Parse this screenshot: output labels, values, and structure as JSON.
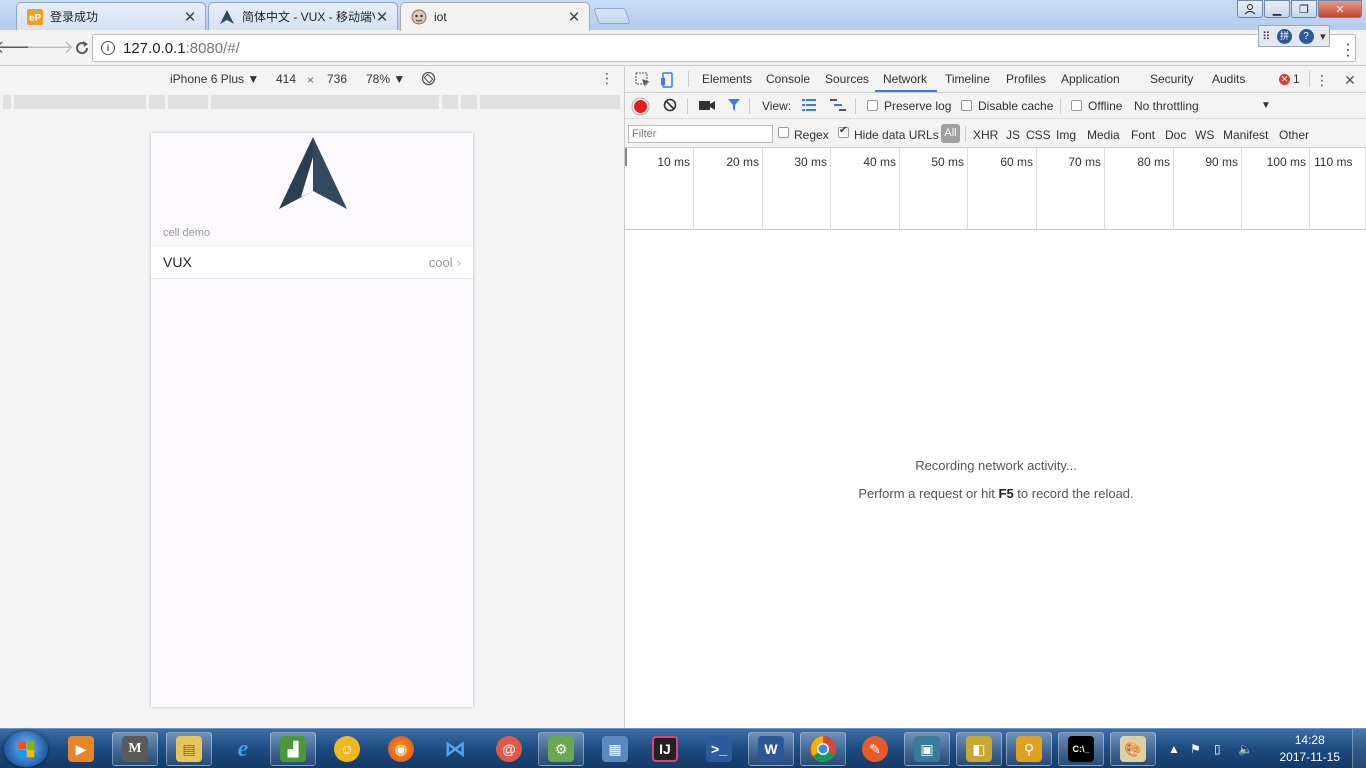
{
  "tabs": [
    {
      "title": "登录成功",
      "icon": "ep-icon"
    },
    {
      "title": "简体中文 - VUX - 移动端V",
      "icon": "vux-icon"
    },
    {
      "title": "iot",
      "icon": "iot-favicon"
    }
  ],
  "toolbar": {
    "url_host": "127.0.0.1",
    "url_rest": ":8080/#/"
  },
  "device_toolbar": {
    "device": "iPhone 6 Plus",
    "width": "414",
    "times": "×",
    "height": "736",
    "zoom": "78%"
  },
  "app": {
    "cell_title": "cell demo",
    "cell_label": "VUX",
    "cell_value": "cool"
  },
  "devtools": {
    "tabs": [
      "Elements",
      "Console",
      "Sources",
      "Network",
      "Timeline",
      "Profiles",
      "Application",
      "Security",
      "Audits"
    ],
    "active_tab": "Network",
    "error_count": "1",
    "view_label": "View:",
    "preserve_log": "Preserve log",
    "disable_cache": "Disable cache",
    "offline": "Offline",
    "throttling": "No throttling",
    "filter_placeholder": "Filter",
    "regex": "Regex",
    "hide_data_urls": "Hide data URLs",
    "types": [
      "All",
      "XHR",
      "JS",
      "CSS",
      "Img",
      "Media",
      "Font",
      "Doc",
      "WS",
      "Manifest",
      "Other"
    ],
    "ticks": [
      "10 ms",
      "20 ms",
      "30 ms",
      "40 ms",
      "50 ms",
      "60 ms",
      "70 ms",
      "80 ms",
      "90 ms",
      "100 ms",
      "110 ms"
    ],
    "empty_title": "Recording network activity...",
    "hint_pre": "Perform a request or hit ",
    "hint_key": "F5",
    "hint_post": " to record the reload."
  },
  "taskbar": {
    "time": "14:28",
    "date": "2017-11-15",
    "apps": [
      "video-player",
      "m-app",
      "file-explorer",
      "internet-explorer",
      "chart-app",
      "mascot-app",
      "firefox",
      "visual-studio",
      "snail-app",
      "network-app",
      "folder-app",
      "intellij",
      "powershell",
      "word",
      "chrome",
      "fiddler-app",
      "remote-desktop",
      "stack-app",
      "search-app",
      "terminal",
      "paint"
    ]
  },
  "colors": {
    "accent": "#3b7be8",
    "record": "#e02020",
    "logo": "#35495e"
  }
}
